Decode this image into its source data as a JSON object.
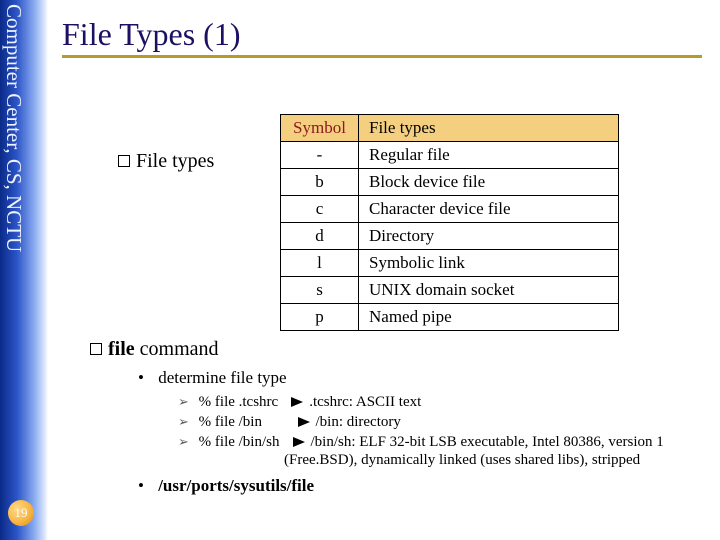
{
  "sidebar": {
    "label": "Computer Center, CS, NCTU",
    "page_number": "19"
  },
  "title": "File Types (1)",
  "bullets": {
    "file_types_label": "File types",
    "file_command_label_prefix": "file",
    "file_command_label_suffix": " command",
    "determine": "determine file type",
    "path": "/usr/ports/sysutils/file"
  },
  "examples": {
    "e1_cmd": "% file .tcshrc",
    "e1_out": " .tcshrc: ASCII text",
    "e2_cmd": "% file /bin",
    "e2_out": " /bin: directory",
    "e3_cmd": "% file /bin/sh",
    "e3_out": " /bin/sh: ELF 32-bit LSB executable, Intel 80386, version 1",
    "e3_out2": "(Free.BSD), dynamically linked (uses shared libs), stripped"
  },
  "table": {
    "headers": {
      "symbol": "Symbol",
      "filetypes": "File types"
    },
    "rows": [
      {
        "sym": "-",
        "desc": "Regular file"
      },
      {
        "sym": "b",
        "desc": "Block device file"
      },
      {
        "sym": "c",
        "desc": "Character device file"
      },
      {
        "sym": "d",
        "desc": "Directory"
      },
      {
        "sym": "l",
        "desc": "Symbolic link"
      },
      {
        "sym": "s",
        "desc": "UNIX domain socket"
      },
      {
        "sym": "p",
        "desc": "Named pipe"
      }
    ]
  }
}
